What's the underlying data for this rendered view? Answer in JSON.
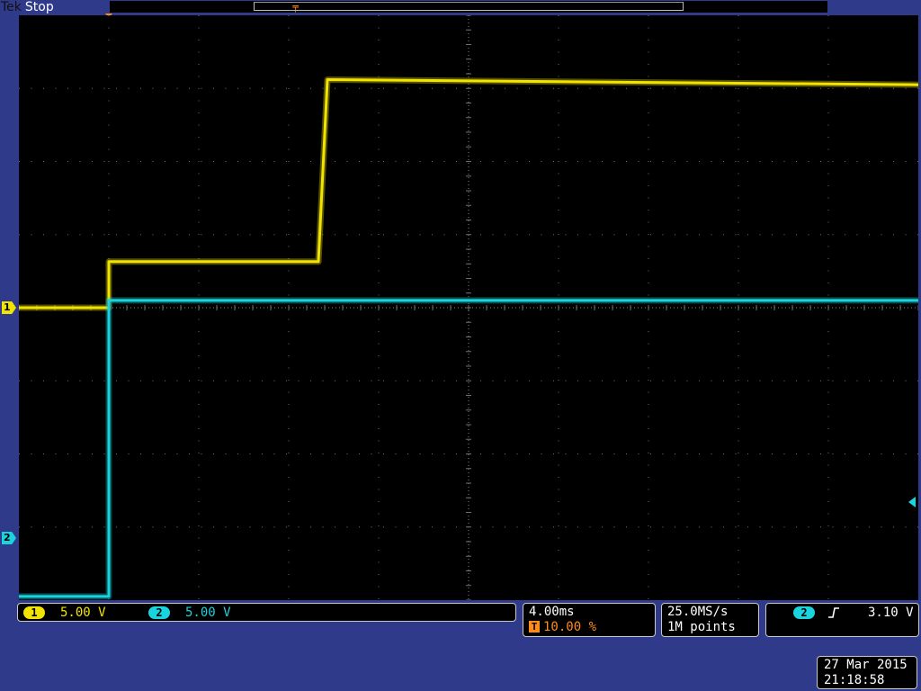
{
  "header": {
    "brand": "Tek",
    "run_state": "Stop"
  },
  "colors": {
    "ch1": "#f2e400",
    "ch2": "#19d3de",
    "trigger": "#ff8c1a",
    "graticule": "#6f6f6f",
    "background": "#000000",
    "frame": "#2f3a8a"
  },
  "markers": {
    "ch1": "1",
    "ch2": "2",
    "trigger": "T"
  },
  "channels": [
    {
      "id": "1",
      "scale": "5.00 V"
    },
    {
      "id": "2",
      "scale": "5.00 V"
    }
  ],
  "horizontal": {
    "scale": "4.00ms",
    "trigger_position": "10.00 %"
  },
  "acquisition": {
    "sample_rate": "25.0MS/s",
    "record_length": "1M points"
  },
  "trigger": {
    "source": "2",
    "slope_icon": "rising-edge-icon",
    "level": "3.10 V"
  },
  "timestamp": {
    "date": "27 Mar 2015",
    "time": "21:18:58"
  },
  "chart_data": {
    "type": "line",
    "grid": true,
    "x_divisions": 10,
    "y_divisions": 8,
    "xlim": [
      -1,
      9
    ],
    "ylim": [
      -4,
      4
    ],
    "x_unit": "div",
    "y_unit": "div",
    "series": [
      {
        "name": "1",
        "color": "#f2e400",
        "x": [
          -1.0,
          0.0,
          0.0,
          2.33,
          2.43,
          9.0
        ],
        "y": [
          0.0,
          0.0,
          0.63,
          0.63,
          3.12,
          3.05
        ]
      },
      {
        "name": "2",
        "color": "#19d3de",
        "x": [
          -1.0,
          0.0,
          0.0,
          9.0
        ],
        "y": [
          -3.95,
          -3.95,
          0.1,
          0.1
        ]
      }
    ]
  }
}
